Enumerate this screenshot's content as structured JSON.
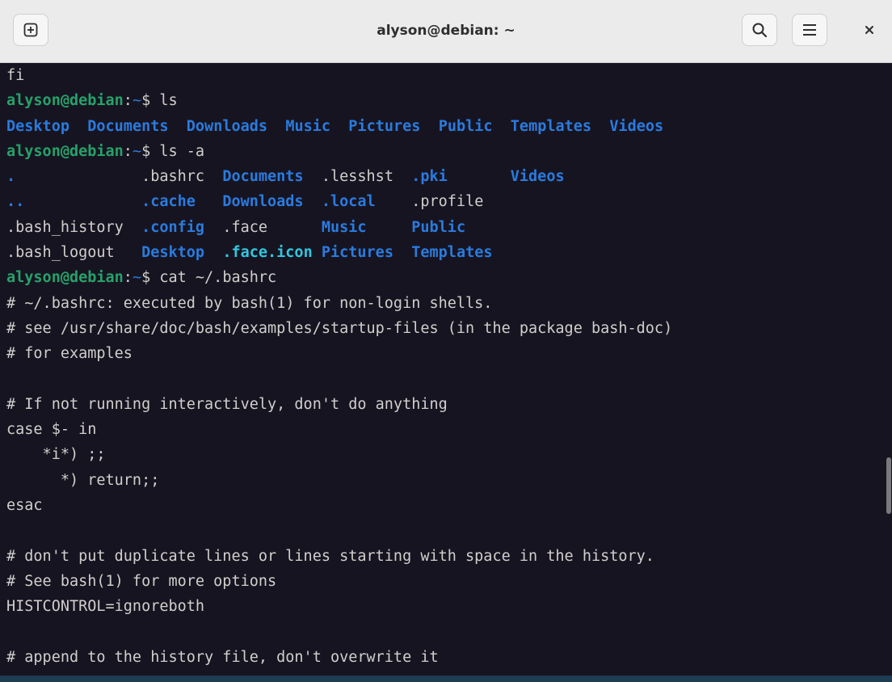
{
  "window": {
    "title": "alyson@debian: ~",
    "new_tab_icon": "plus-square-icon",
    "search_icon": "search-icon",
    "menu_icon": "hamburger-icon",
    "close_icon": "close-icon"
  },
  "colors": {
    "user": "#26a269",
    "path": "#2a7bde",
    "dir": "#2a7bde",
    "symlink": "#33c7de",
    "text": "#d0cfcc",
    "background": "#171421"
  },
  "terminal": {
    "lines": [
      [
        {
          "t": "fi"
        }
      ],
      [
        {
          "t": "alyson@debian",
          "c": "user"
        },
        {
          "t": ":"
        },
        {
          "t": "~",
          "c": "path"
        },
        {
          "t": "$ ls"
        }
      ],
      [
        {
          "t": "Desktop",
          "c": "dir"
        },
        {
          "t": "  "
        },
        {
          "t": "Documents",
          "c": "dir"
        },
        {
          "t": "  "
        },
        {
          "t": "Downloads",
          "c": "dir"
        },
        {
          "t": "  "
        },
        {
          "t": "Music",
          "c": "dir"
        },
        {
          "t": "  "
        },
        {
          "t": "Pictures",
          "c": "dir"
        },
        {
          "t": "  "
        },
        {
          "t": "Public",
          "c": "dir"
        },
        {
          "t": "  "
        },
        {
          "t": "Templates",
          "c": "dir"
        },
        {
          "t": "  "
        },
        {
          "t": "Videos",
          "c": "dir"
        }
      ],
      [
        {
          "t": "alyson@debian",
          "c": "user"
        },
        {
          "t": ":"
        },
        {
          "t": "~",
          "c": "path"
        },
        {
          "t": "$ ls -a"
        }
      ],
      [
        {
          "t": ".",
          "c": "dir"
        },
        {
          "t": "              .bashrc  "
        },
        {
          "t": "Documents",
          "c": "dir"
        },
        {
          "t": "  .lesshst  "
        },
        {
          "t": ".pki",
          "c": "dir"
        },
        {
          "t": "       "
        },
        {
          "t": "Videos",
          "c": "dir"
        }
      ],
      [
        {
          "t": "..",
          "c": "dir"
        },
        {
          "t": "             "
        },
        {
          "t": ".cache",
          "c": "dir"
        },
        {
          "t": "   "
        },
        {
          "t": "Downloads",
          "c": "dir"
        },
        {
          "t": "  "
        },
        {
          "t": ".local",
          "c": "dir"
        },
        {
          "t": "    .profile"
        }
      ],
      [
        {
          "t": ".bash_history  "
        },
        {
          "t": ".config",
          "c": "dir"
        },
        {
          "t": "  .face      "
        },
        {
          "t": "Music",
          "c": "dir"
        },
        {
          "t": "     "
        },
        {
          "t": "Public",
          "c": "dir"
        }
      ],
      [
        {
          "t": ".bash_logout   "
        },
        {
          "t": "Desktop",
          "c": "dir"
        },
        {
          "t": "  "
        },
        {
          "t": ".face.icon",
          "c": "symlink"
        },
        {
          "t": " "
        },
        {
          "t": "Pictures",
          "c": "dir"
        },
        {
          "t": "  "
        },
        {
          "t": "Templates",
          "c": "dir"
        }
      ],
      [
        {
          "t": "alyson@debian",
          "c": "user"
        },
        {
          "t": ":"
        },
        {
          "t": "~",
          "c": "path"
        },
        {
          "t": "$ cat ~/.bashrc"
        }
      ],
      [
        {
          "t": "# ~/.bashrc: executed by bash(1) for non-login shells."
        }
      ],
      [
        {
          "t": "# see /usr/share/doc/bash/examples/startup-files (in the package bash-doc)"
        }
      ],
      [
        {
          "t": "# for examples"
        }
      ],
      [
        {
          "t": ""
        }
      ],
      [
        {
          "t": "# If not running interactively, don't do anything"
        }
      ],
      [
        {
          "t": "case $- in"
        }
      ],
      [
        {
          "t": "    *i*) ;;"
        }
      ],
      [
        {
          "t": "      *) return;;"
        }
      ],
      [
        {
          "t": "esac"
        }
      ],
      [
        {
          "t": ""
        }
      ],
      [
        {
          "t": "# don't put duplicate lines or lines starting with space in the history."
        }
      ],
      [
        {
          "t": "# See bash(1) for more options"
        }
      ],
      [
        {
          "t": "HISTCONTROL=ignoreboth"
        }
      ],
      [
        {
          "t": ""
        }
      ],
      [
        {
          "t": "# append to the history file, don't overwrite it"
        }
      ]
    ]
  }
}
